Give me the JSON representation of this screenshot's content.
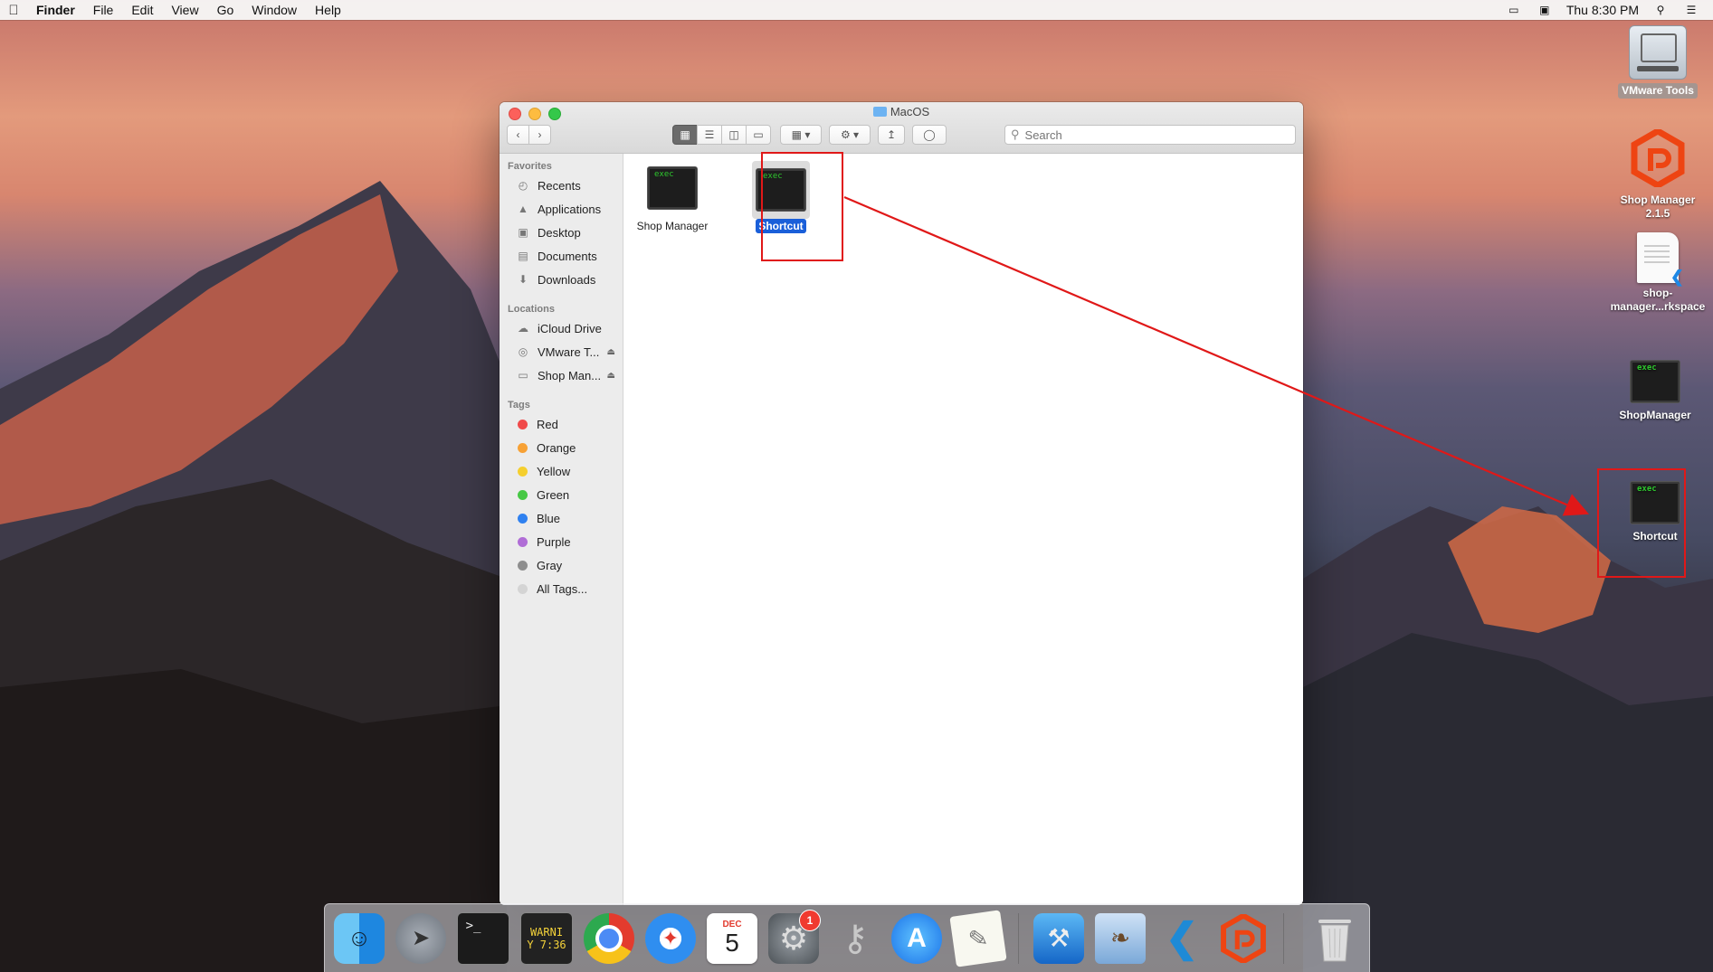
{
  "menubar": {
    "app": "Finder",
    "items": [
      "File",
      "Edit",
      "View",
      "Go",
      "Window",
      "Help"
    ],
    "clock": "Thu 8:30 PM"
  },
  "window": {
    "title": "MacOS",
    "search_placeholder": "Search",
    "sidebar": {
      "favorites_header": "Favorites",
      "favorites": [
        {
          "label": "Recents",
          "icon": "clock-icon"
        },
        {
          "label": "Applications",
          "icon": "applications-icon"
        },
        {
          "label": "Desktop",
          "icon": "desktop-icon"
        },
        {
          "label": "Documents",
          "icon": "documents-icon"
        },
        {
          "label": "Downloads",
          "icon": "downloads-icon"
        }
      ],
      "locations_header": "Locations",
      "locations": [
        {
          "label": "iCloud Drive",
          "icon": "cloud-icon"
        },
        {
          "label": "VMware T...",
          "icon": "disc-icon"
        },
        {
          "label": "Shop Man...",
          "icon": "disk-icon"
        }
      ],
      "tags_header": "Tags",
      "tags": [
        {
          "label": "Red",
          "color": "#f04a4a"
        },
        {
          "label": "Orange",
          "color": "#f7a135"
        },
        {
          "label": "Yellow",
          "color": "#f5cf2e"
        },
        {
          "label": "Green",
          "color": "#47c845"
        },
        {
          "label": "Blue",
          "color": "#2f81f0"
        },
        {
          "label": "Purple",
          "color": "#b06dd6"
        },
        {
          "label": "Gray",
          "color": "#8e8e8e"
        },
        {
          "label": "All Tags...",
          "color": "#d4d4d4"
        }
      ]
    },
    "files": [
      {
        "name": "Shop Manager",
        "icon_text": "exec",
        "selected": false
      },
      {
        "name": "Shortcut",
        "icon_text": "exec",
        "selected": true
      }
    ]
  },
  "desktop": {
    "icons": [
      {
        "label": "VMware Tools"
      },
      {
        "label": "Shop Manager 2.1.5"
      },
      {
        "label": "shop-manager...rkspace"
      },
      {
        "label": "ShopManager",
        "icon_text": "exec"
      },
      {
        "label": "Shortcut",
        "icon_text": "exec"
      }
    ]
  },
  "dock": {
    "terminal_warning_line1": "WARNI",
    "terminal_warning_line2": "Y 7:36",
    "calendar_month": "DEC",
    "calendar_day": "5",
    "prefs_badge": "1",
    "terminal_prompt": ">_"
  },
  "colors": {
    "annotation": "#e01818",
    "selection": "#1a5fd9"
  }
}
